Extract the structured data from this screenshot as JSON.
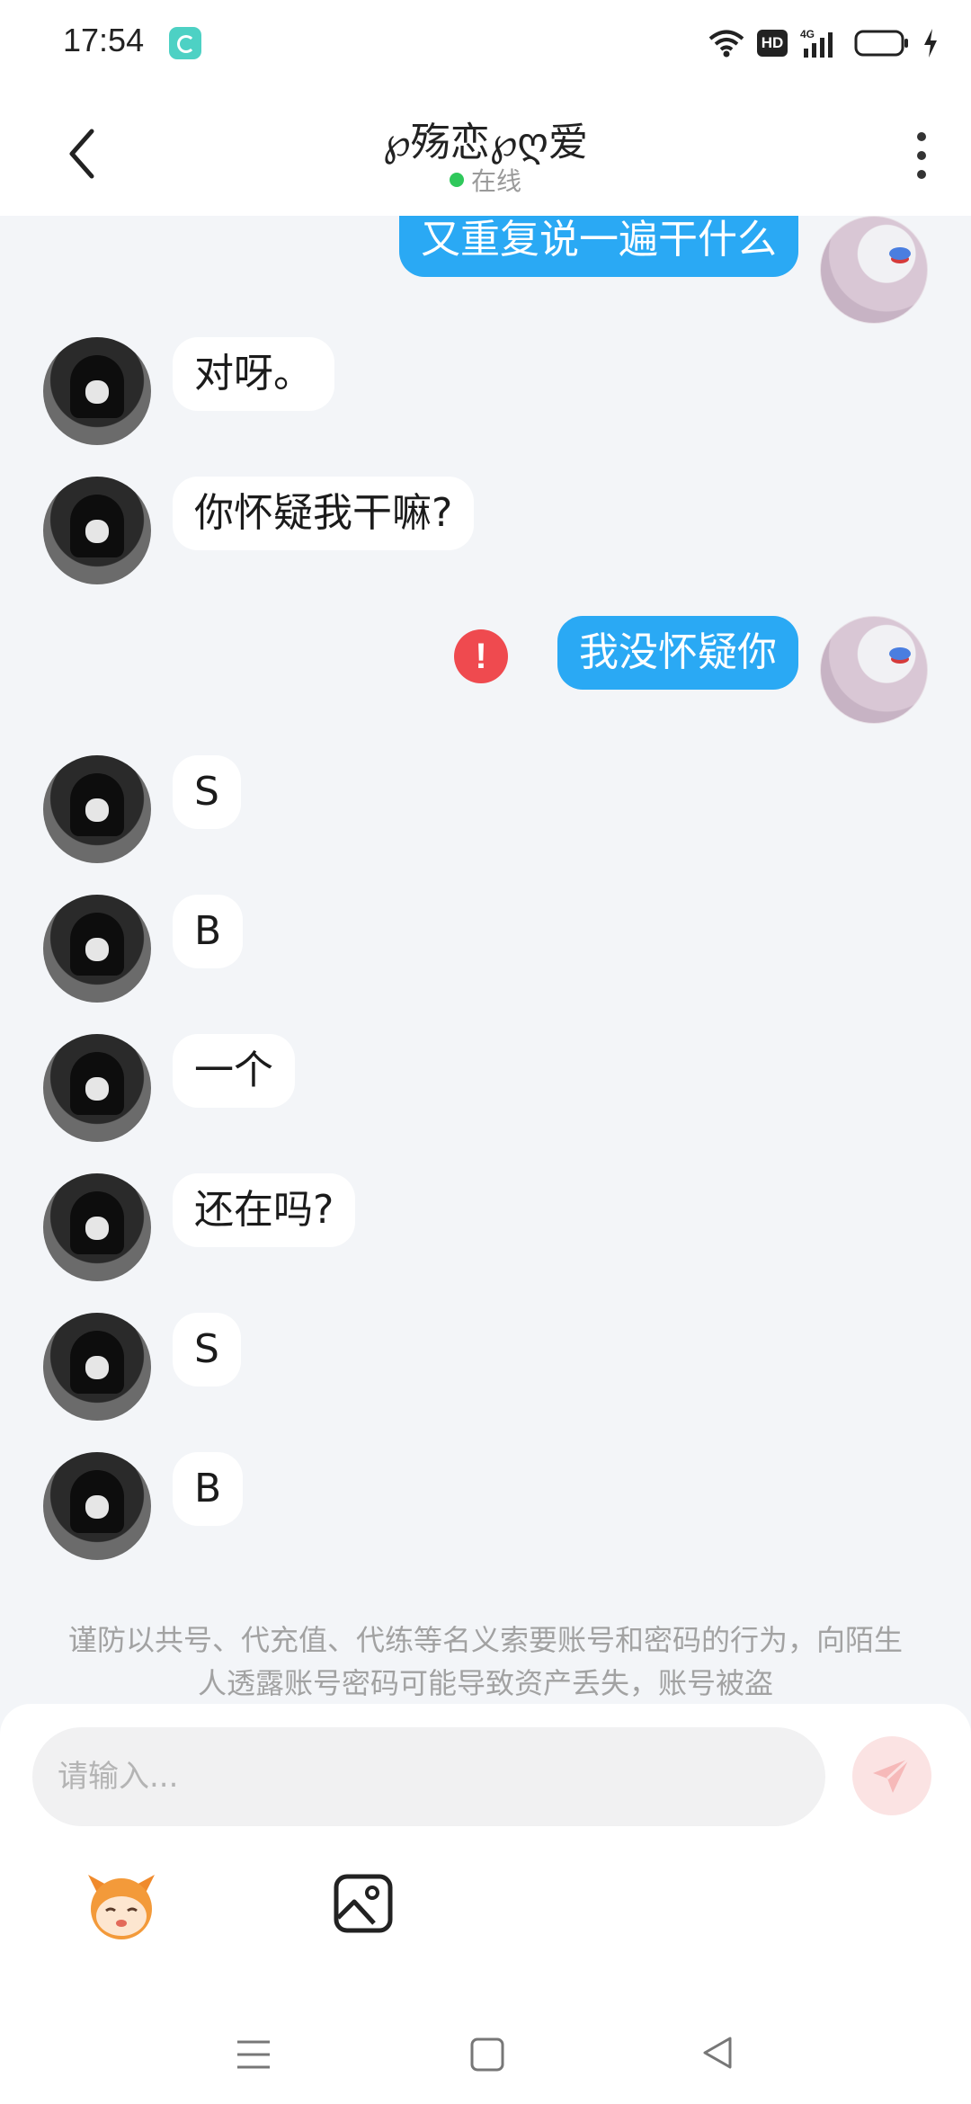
{
  "status_bar": {
    "time": "17:54",
    "hd_label": "HD",
    "network_label": "4G"
  },
  "header": {
    "title": "℘殇恋℘ღ爱",
    "status": "在线"
  },
  "messages": [
    {
      "sender": "me",
      "text": "又重复说一遍干什么"
    },
    {
      "sender": "other",
      "text": "对呀。"
    },
    {
      "sender": "other",
      "text": "你怀疑我干嘛?"
    },
    {
      "sender": "me",
      "text": "我没怀疑你",
      "failed": true
    },
    {
      "sender": "other",
      "text": "S"
    },
    {
      "sender": "other",
      "text": "B"
    },
    {
      "sender": "other",
      "text": "一个"
    },
    {
      "sender": "other",
      "text": "还在吗?"
    },
    {
      "sender": "other",
      "text": "S"
    },
    {
      "sender": "other",
      "text": "B"
    }
  ],
  "error_mark": "!",
  "notice": "谨防以共号、代充值、代练等名义索要账号和密码的行为，向陌生人透露账号密码可能导致资产丢失，账号被盗",
  "input": {
    "placeholder": "请输入..."
  },
  "icons": {
    "back": "back-arrow-icon",
    "more": "more-vertical-icon",
    "send": "send-icon",
    "emoji": "emoji-sticker-icon",
    "image": "image-icon"
  },
  "colors": {
    "my_bubble": "#2aa9f4",
    "other_bubble": "#ffffff",
    "background": "#f3f5f8",
    "error": "#ef4a4f",
    "online": "#2fc85b"
  }
}
